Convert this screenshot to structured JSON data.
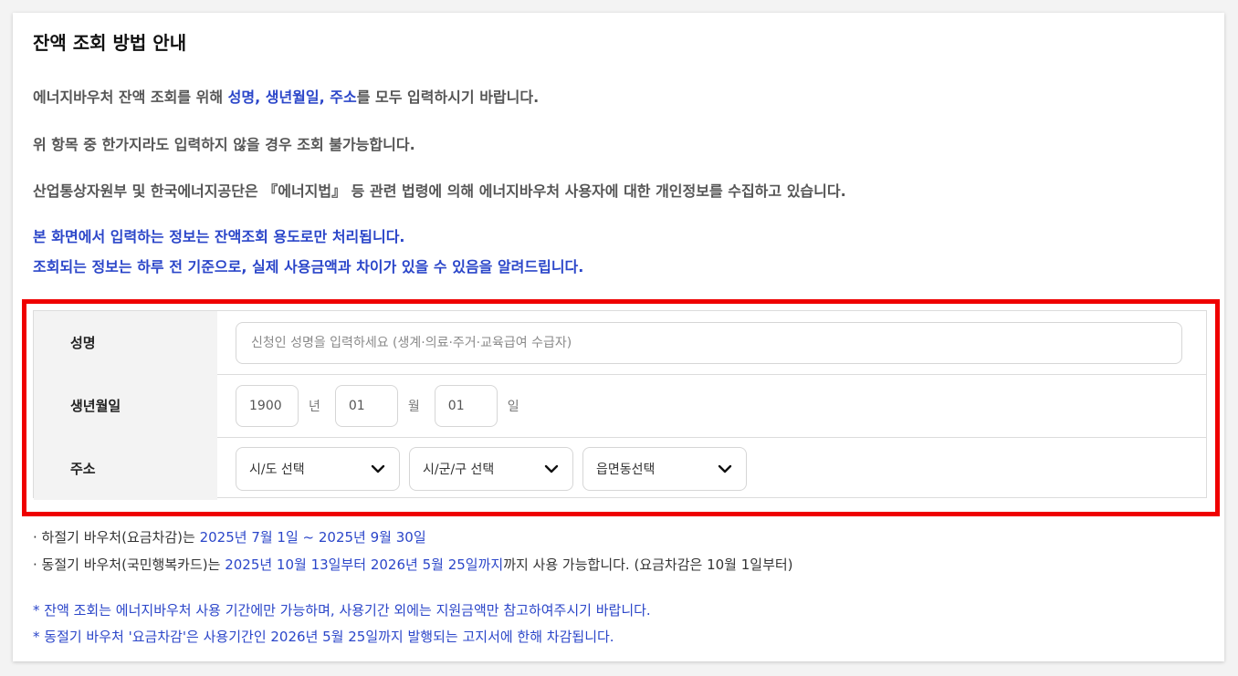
{
  "title": "잔액 조회 방법 안내",
  "intro": {
    "line1_prefix": "에너지바우처 잔액 조회를 위해 ",
    "line1_highlight": "성명, 생년월일, 주소",
    "line1_suffix": "를 모두 입력하시기 바랍니다.",
    "line2": "위 항목 중 한가지라도 입력하지 않을 경우 조회 불가능합니다.",
    "line3": "산업통상자원부 및 한국에너지공단은 『에너지법』 등 관련 법령에 의해 에너지바우처 사용자에 대한 개인정보를 수집하고 있습니다.",
    "line4": "본 화면에서 입력하는 정보는 잔액조회 용도로만 처리됩니다.",
    "line5": "조회되는 정보는 하루 전 기준으로, 실제 사용금액과 차이가 있을 수 있음을 알려드립니다."
  },
  "form": {
    "name_label": "성명",
    "name_placeholder": "신청인 성명을 입력하세요 (생계·의료·주거·교육급여 수급자)",
    "birth_label": "생년월일",
    "birth_year": "1900",
    "year_unit": "년",
    "birth_month": "01",
    "month_unit": "월",
    "birth_day": "01",
    "day_unit": "일",
    "address_label": "주소",
    "sido_select": "시/도 선택",
    "sigungu_select": "시/군/구 선택",
    "eupmyeondong_select": "읍면동선택"
  },
  "notes": {
    "summer_prefix": "· 하절기 바우처(요금차감)는 ",
    "summer_period": "2025년 7월 1일 ~ 2025년 9월 30일",
    "winter_prefix": "· 동절기 바우처(국민행복카드)는 ",
    "winter_period": "2025년 10월 13일부터 2026년 5월 25일까지",
    "winter_suffix": "까지 사용 가능합니다. (요금차감은 10월 1일부터)",
    "star1": "* 잔액 조회는 에너지바우처 사용 기간에만 가능하며, 사용기간 외에는 지원금액만 참고하여주시기 바랍니다.",
    "star2": "* 동절기 바우처 '요금차감'은 사용기간인 2026년 5월 25일까지 발행되는 고지서에 한해 차감됩니다."
  },
  "colors": {
    "accent_blue": "#2b46c9",
    "highlight_border": "#ef0000"
  },
  "icons": {
    "select_chevron": "chevron-down-icon"
  }
}
